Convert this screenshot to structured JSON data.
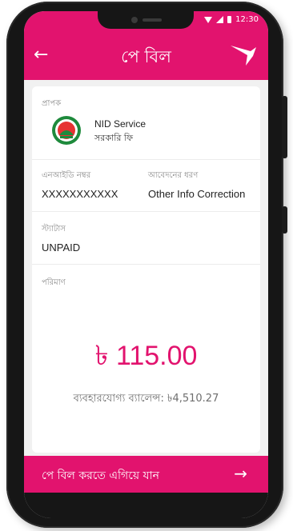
{
  "statusbar": {
    "time": "12:30"
  },
  "appbar": {
    "back_icon": "←",
    "title": "পে বিল",
    "logo_icon": "bkash-bird-icon"
  },
  "recipient": {
    "label": "প্রাপক",
    "name": "NID Service",
    "subtitle": "সরকারি ফি"
  },
  "details": {
    "nid_label": "এনআইডি নম্বর",
    "nid_value": "XXXXXXXXXXX",
    "type_label": "আবেদনের ধরণ",
    "type_value": "Other Info Correction"
  },
  "status": {
    "label": "স্ট্যাটাস",
    "value": "UNPAID"
  },
  "amount": {
    "label": "পরিমাণ",
    "value": "৳ 115.00",
    "balance": "ব্যবহারযোগ্য ব্যালেন্স: ৳4,510.27"
  },
  "proceed": {
    "label": "পে বিল করতে এগিয়ে যান",
    "arrow": "→"
  },
  "colors": {
    "brand": "#e2136e",
    "background": "#f1f1f1",
    "card": "#ffffff"
  }
}
